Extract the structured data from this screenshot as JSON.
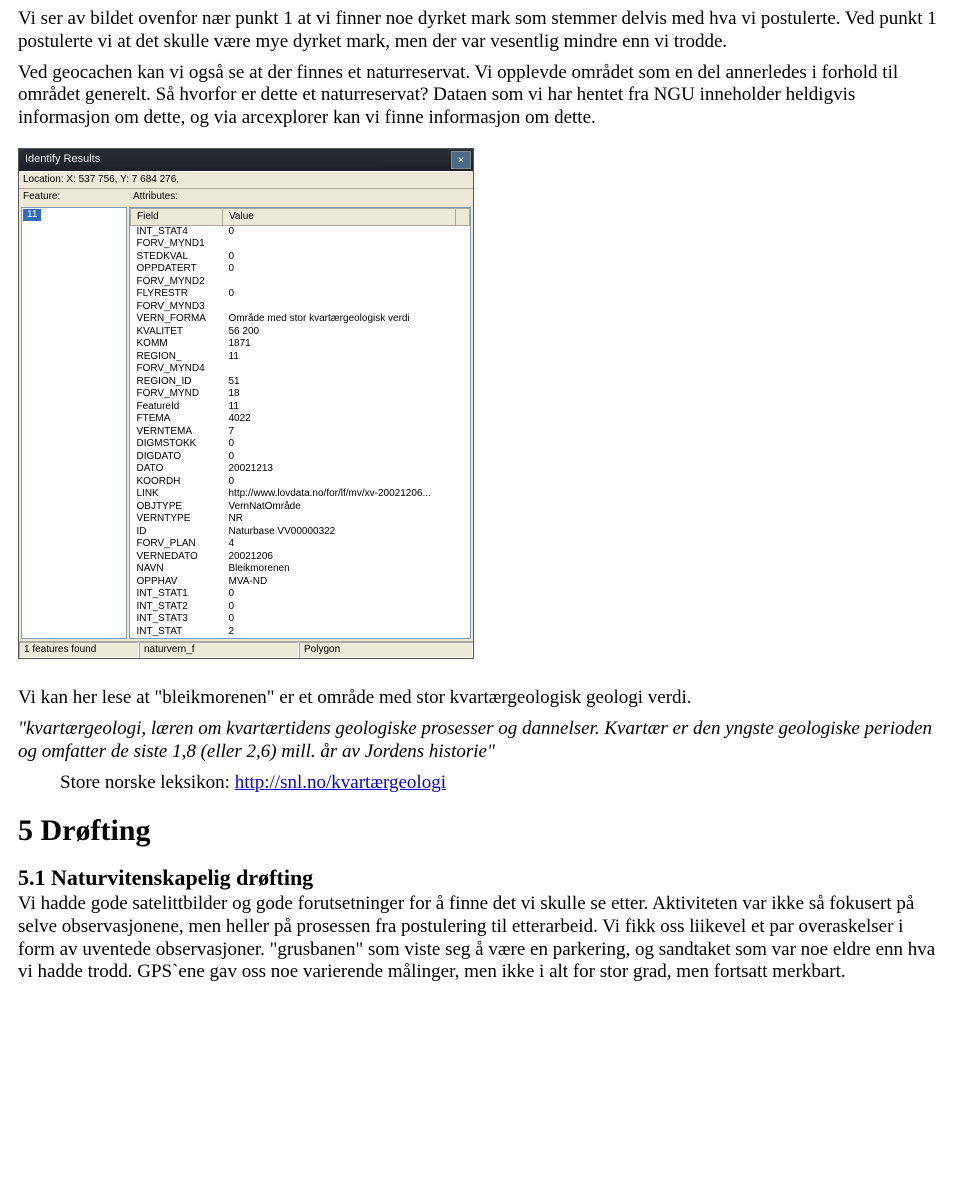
{
  "text": {
    "p1": "Vi ser av bildet ovenfor nær punkt 1 at vi finner noe dyrket mark som stemmer delvis med hva vi postulerte. Ved punkt 1 postulerte vi at det skulle være mye dyrket mark, men der var vesentlig mindre enn vi trodde.",
    "p2": "Ved geocachen kan vi også se at der finnes et naturreservat. Vi opplevde området som en del annerledes i forhold til området generelt. Så hvorfor er dette et naturreservat? Dataen som vi har hentet fra NGU inneholder heldigvis informasjon om dette, og via arcexplorer kan vi finne informasjon om dette.",
    "p3": "Vi kan her lese at \"bleikmorenen\" er et område med stor kvartærgeologisk geologi verdi.",
    "quote": "\"kvartærgeologi, læren om kvartærtidens geologiske prosesser og dannelser. Kvartær er den yngste geologiske perioden og omfatter de siste 1,8 (eller 2,6) mill. år av Jordens historie\"",
    "citation": "Store norske leksikon: ",
    "link_label": "http://snl.no/kvartærgeologi",
    "h1": "5 Drøfting",
    "h2": "5.1 Naturvitenskapelig drøfting",
    "p4": "Vi hadde gode satelittbilder og gode forutsetninger for å finne det vi skulle se etter. Aktiviteten var ikke så fokusert på selve observasjonene, men heller på prosessen fra postulering til etterarbeid. Vi fikk oss liikevel et par overaskelser i form av uventede observasjoner. \"grusbanen\" som viste seg å være en parkering, og sandtaket som var noe eldre enn hva vi hadde trodd. GPS`ene gav oss noe varierende målinger, men ikke i alt for stor grad, men fortsatt merkbart."
  },
  "dialog": {
    "title": "Identify Results",
    "location_label": "Location: X: 537 756, Y: 7 684 276,",
    "feature_hdr": "Feature:",
    "attributes_hdr": "Attributes:",
    "feature_selected": "11",
    "col_field": "Field",
    "col_value": "Value",
    "rows": [
      {
        "f": "INT_STAT4",
        "v": "0"
      },
      {
        "f": "FORV_MYND1",
        "v": ""
      },
      {
        "f": "STEDKVAL",
        "v": "0"
      },
      {
        "f": "OPPDATERT",
        "v": "0"
      },
      {
        "f": "FORV_MYND2",
        "v": ""
      },
      {
        "f": "FLYRESTR",
        "v": "0"
      },
      {
        "f": "FORV_MYND3",
        "v": ""
      },
      {
        "f": "VERN_FORMA",
        "v": "Område med stor kvartærgeologisk verdi"
      },
      {
        "f": "KVALITET",
        "v": "56 200"
      },
      {
        "f": "KOMM",
        "v": "1871"
      },
      {
        "f": "REGION_",
        "v": "11"
      },
      {
        "f": "FORV_MYND4",
        "v": ""
      },
      {
        "f": "REGION_ID",
        "v": "51"
      },
      {
        "f": "FORV_MYND",
        "v": "18"
      },
      {
        "f": "FeatureId",
        "v": "11"
      },
      {
        "f": "FTEMA",
        "v": "4022"
      },
      {
        "f": "VERNTEMA",
        "v": "7"
      },
      {
        "f": "DIGMSTOKK",
        "v": "0"
      },
      {
        "f": "DIGDATO",
        "v": "0"
      },
      {
        "f": "DATO",
        "v": "20021213"
      },
      {
        "f": "KOORDH",
        "v": "0"
      },
      {
        "f": "LINK",
        "v": "http://www.lovdata.no/for/lf/mv/xv-20021206..."
      },
      {
        "f": "OBJTYPE",
        "v": "VernNatOmråde"
      },
      {
        "f": "VERNTYPE",
        "v": "NR"
      },
      {
        "f": "ID",
        "v": "Naturbase VV00000322"
      },
      {
        "f": "FORV_PLAN",
        "v": "4"
      },
      {
        "f": "VERNEDATO",
        "v": "20021206"
      },
      {
        "f": "NAVN",
        "v": "Bleikmorenen"
      },
      {
        "f": "OPPHAV",
        "v": "MVA-ND"
      },
      {
        "f": "INT_STAT1",
        "v": "0"
      },
      {
        "f": "INT_STAT2",
        "v": "0"
      },
      {
        "f": "INT_STAT3",
        "v": "0"
      },
      {
        "f": "INT_STAT",
        "v": "2"
      }
    ],
    "status_left": "1 features found",
    "status_mid": "naturvern_f",
    "status_right": "Polygon"
  }
}
